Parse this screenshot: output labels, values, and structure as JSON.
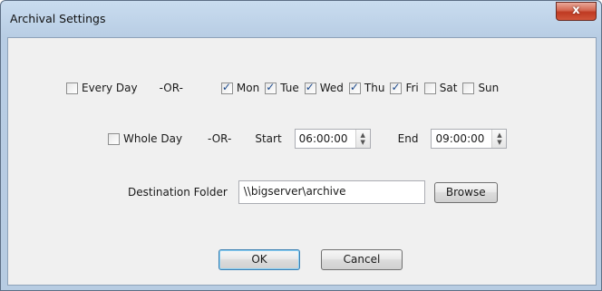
{
  "window": {
    "title": "Archival Settings",
    "close_glyph": "x"
  },
  "days_row": {
    "every_day": {
      "label": "Every Day",
      "checked": false
    },
    "or_label": "-OR-",
    "days": [
      {
        "label": "Mon",
        "checked": true
      },
      {
        "label": "Tue",
        "checked": true
      },
      {
        "label": "Wed",
        "checked": true
      },
      {
        "label": "Thu",
        "checked": true
      },
      {
        "label": "Fri",
        "checked": true
      },
      {
        "label": "Sat",
        "checked": false
      },
      {
        "label": "Sun",
        "checked": false
      }
    ]
  },
  "time_row": {
    "whole_day": {
      "label": "Whole Day",
      "checked": false
    },
    "or_label": "-OR-",
    "start_label": "Start",
    "start_value": "06:00:00",
    "end_label": "End",
    "end_value": "09:00:00"
  },
  "destination": {
    "label": "Destination Folder",
    "value": "\\\\bigserver\\archive",
    "browse_label": "Browse"
  },
  "buttons": {
    "ok": "OK",
    "cancel": "Cancel"
  },
  "colors": {
    "titlebar": "#c9dcef",
    "client": "#f0f0f0",
    "close": "#c9452d",
    "check": "#1d4a8c"
  }
}
